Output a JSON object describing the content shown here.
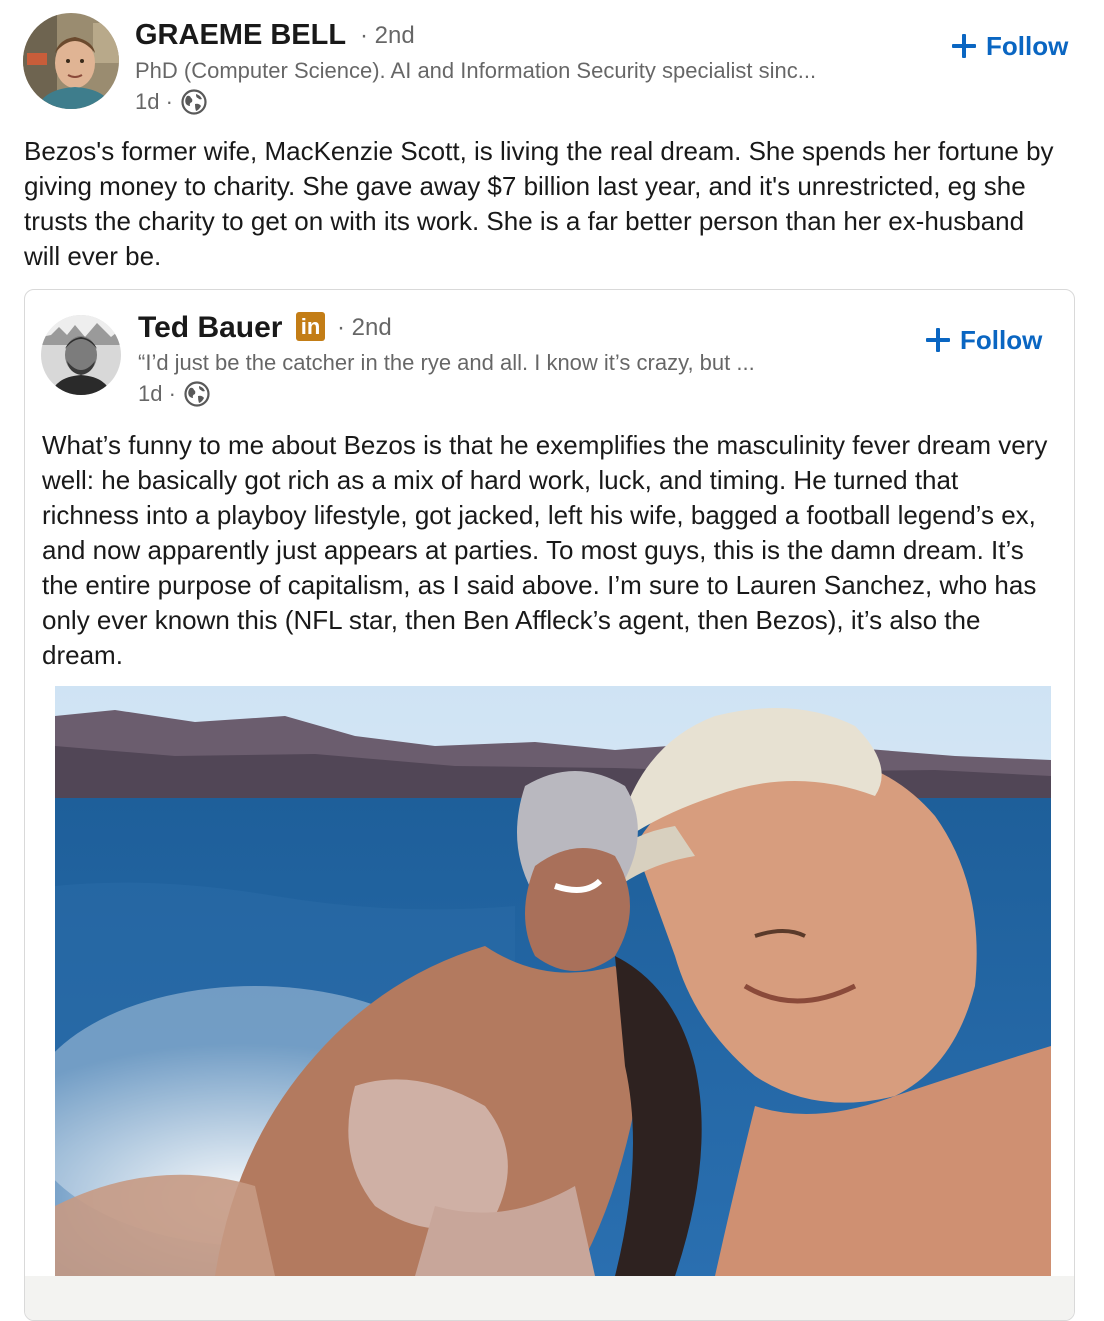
{
  "post": {
    "author": {
      "name": "GRAEME BELL",
      "degree": "· 2nd",
      "headline": "PhD (Computer Science). AI and Information Security specialist sinc...",
      "time": "1d ·",
      "visibility_icon": "globe-icon",
      "follow_label": "Follow"
    },
    "text": "Bezos's former wife, MacKenzie Scott, is living the real dream. She spends her fortune by giving money to charity. She gave away $7 billion last year, and it's unrestricted, eg she trusts the charity to get on with its work. She is a far better person than her ex-husband will ever be."
  },
  "shared_post": {
    "author": {
      "name": "Ted Bauer",
      "badge": "in",
      "degree": "· 2nd",
      "headline": "“I’d just be the catcher in the rye and all. I know it’s crazy, but ...",
      "time": "1d ·",
      "visibility_icon": "globe-icon",
      "follow_label": "Follow"
    },
    "text": "What’s funny to me about Bezos is that he exemplifies the masculinity fever dream very well: he basically got rich as a mix of hard work, luck, and timing. He turned that richness into a playboy lifestyle, got jacked, left his wife, bagged a football legend’s ex, and now apparently just appears at parties. To most guys, this is the damn dream. It’s the entire purpose of capitalism, as I said above. I’m sure to Lauren Sanchez, who has only ever known this (NFL star, then Ben Affleck’s agent, then Bezos), it’s also the dream."
  },
  "colors": {
    "accent": "#0a66c2",
    "premium_badge": "#c37d16",
    "secondary_text": "#666666"
  }
}
